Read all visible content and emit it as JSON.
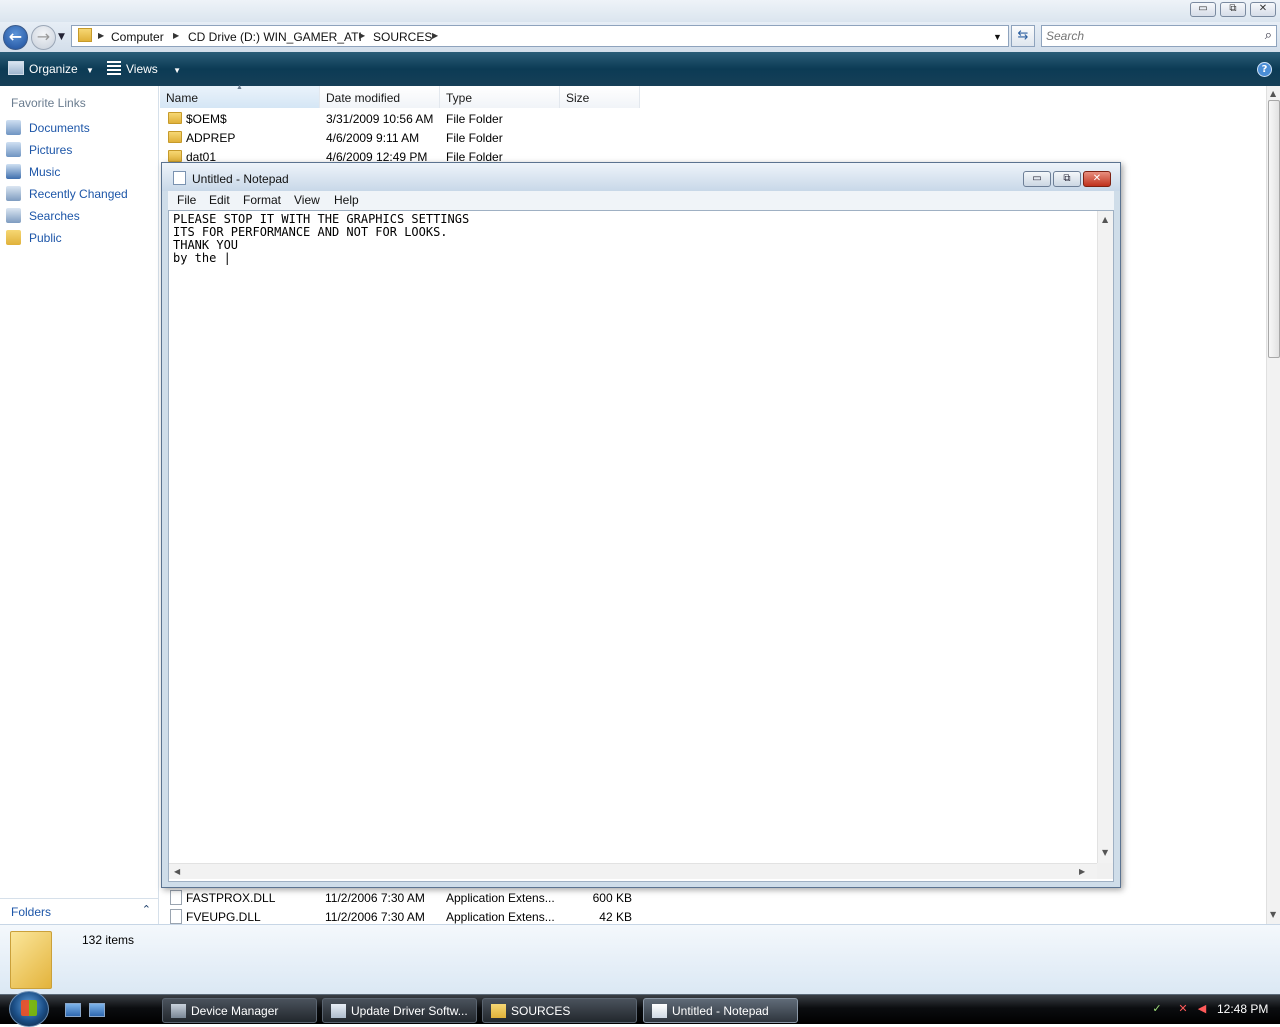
{
  "explorer": {
    "window_buttons": {
      "minimize": "▭",
      "maximize": "⧉",
      "close": "✕"
    },
    "breadcrumb": [
      "Computer",
      "CD Drive (D:) WIN_GAMER_ATI",
      "SOURCES"
    ],
    "search_placeholder": "Search",
    "command_bar": {
      "organize": "Organize",
      "views": "Views",
      "help": "?"
    },
    "nav_pane": {
      "heading": "Favorite Links",
      "links": [
        {
          "label": "Documents",
          "icon": "documents-icon"
        },
        {
          "label": "Pictures",
          "icon": "pictures-icon"
        },
        {
          "label": "Music",
          "icon": "music-icon"
        },
        {
          "label": "Recently Changed",
          "icon": "recently-changed-icon"
        },
        {
          "label": "Searches",
          "icon": "searches-icon"
        },
        {
          "label": "Public",
          "icon": "public-folder-icon"
        }
      ],
      "folders_label": "Folders"
    },
    "columns": [
      "Name",
      "Date modified",
      "Type",
      "Size"
    ],
    "rows_top": [
      {
        "name": "$OEM$",
        "date": "3/31/2009 10:56 AM",
        "type": "File Folder",
        "size": ""
      },
      {
        "name": "ADPREP",
        "date": "4/6/2009 9:11 AM",
        "type": "File Folder",
        "size": ""
      },
      {
        "name": "dat01",
        "date": "4/6/2009 12:49 PM",
        "type": "File Folder",
        "size": ""
      }
    ],
    "rows_bottom": [
      {
        "name": "FASTPROX.DLL",
        "date": "11/2/2006 7:30 AM",
        "type": "Application Extens...",
        "size": "600 KB"
      },
      {
        "name": "FVEUPG.DLL",
        "date": "11/2/2006 7:30 AM",
        "type": "Application Extens...",
        "size": "42 KB"
      }
    ],
    "item_count": "132 items"
  },
  "notepad": {
    "title": "Untitled - Notepad",
    "menu": [
      "File",
      "Edit",
      "Format",
      "View",
      "Help"
    ],
    "text": "PLEASE STOP IT WITH THE GRAPHICS SETTINGS\nITS FOR PERFORMANCE AND NOT FOR LOOKS.\nTHANK YOU\nby the |"
  },
  "taskbar": {
    "buttons": [
      {
        "label": "Device Manager",
        "active": false
      },
      {
        "label": "Update Driver Softw...",
        "active": false
      },
      {
        "label": "SOURCES",
        "active": false
      },
      {
        "label": "Untitled - Notepad",
        "active": true
      }
    ],
    "clock": "12:48 PM"
  },
  "colors": {
    "accent": "#1d56a8",
    "command_bar": "#0c3b55",
    "close_red": "#c0311c"
  }
}
